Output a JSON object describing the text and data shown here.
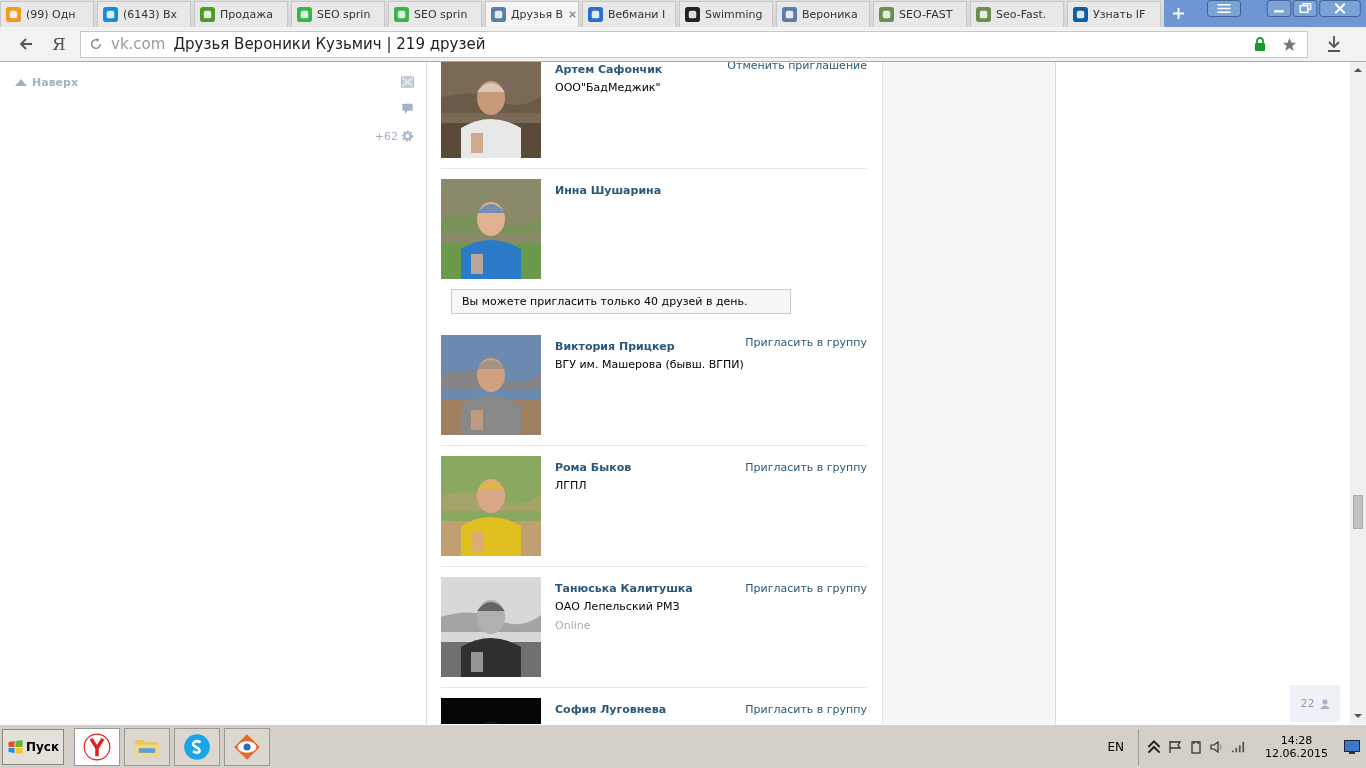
{
  "tabs": [
    {
      "title": "(99) Одн",
      "color": "#f39a1e",
      "selected": false
    },
    {
      "title": "(6143) Вх",
      "color": "#168de2",
      "selected": false
    },
    {
      "title": "Продажа",
      "color": "#4c9a2a",
      "selected": false
    },
    {
      "title": "SEO sprin",
      "color": "#3ab54a",
      "selected": false
    },
    {
      "title": "SEO sprin",
      "color": "#3ab54a",
      "selected": false
    },
    {
      "title": "Друзья В",
      "color": "#5b7fa6",
      "selected": true
    },
    {
      "title": "Вебмани I",
      "color": "#2a6fc9",
      "selected": false
    },
    {
      "title": "Swimming",
      "color": "#222222",
      "selected": false
    },
    {
      "title": "Вероника",
      "color": "#5b7fa6",
      "selected": false
    },
    {
      "title": "SEO-FAST",
      "color": "#6a8f4e",
      "selected": false
    },
    {
      "title": "Seo-Fast.",
      "color": "#6a8f4e",
      "selected": false
    },
    {
      "title": "Узнать IF",
      "color": "#0b5fa5",
      "selected": false
    }
  ],
  "address_bar": {
    "logo": "Я",
    "domain": "vk.com",
    "title": "Друзья Вероники Кузьмич | 219 друзей"
  },
  "sidebar": {
    "top_link": "Наверх",
    "counter": "+62"
  },
  "feed": [
    {
      "kind": "friend",
      "name": "Артем Сафончик",
      "subtitle": "ООО\"БадМеджик\"",
      "action": "Отменить приглашение"
    },
    {
      "kind": "friend",
      "name": "Инна Шушарина"
    },
    {
      "kind": "notice",
      "text": "Вы можете пригласить только 40 друзей в день."
    },
    {
      "kind": "friend",
      "name": "Виктория Прицкер",
      "subtitle": "ВГУ им. Машерова (бывш. ВГПИ)",
      "action": "Пригласить в группу"
    },
    {
      "kind": "friend",
      "name": "Рома Быков",
      "subtitle": "ЛГПЛ",
      "action": "Пригласить в группу"
    },
    {
      "kind": "friend",
      "name": "Танюська Калитушка",
      "subtitle": "ОАО Лепельский РМЗ",
      "status": "Online",
      "action": "Пригласить в группу"
    },
    {
      "kind": "friend",
      "name": "София Луговнева",
      "action": "Пригласить в группу"
    }
  ],
  "friends_widget": {
    "count": "22"
  },
  "taskbar": {
    "start": "Пуск",
    "language": "EN",
    "time": "14:28",
    "date": "12.06.2015"
  }
}
